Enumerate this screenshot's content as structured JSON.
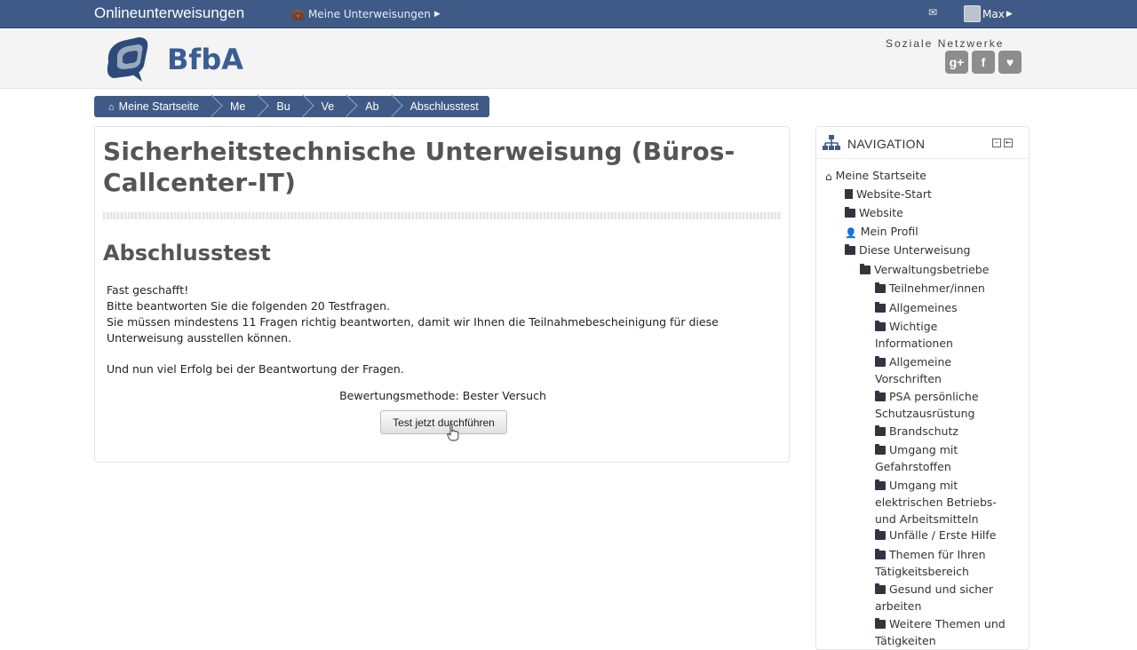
{
  "topbar": {
    "brand": "Onlineunterweisungen",
    "menu_label": "Meine Unterweisungen",
    "user_name": "Max"
  },
  "header": {
    "logo_text": "BfbA",
    "social_title": "Soziale Netzwerke",
    "social": [
      {
        "name": "google-plus-icon",
        "glyph": "g+"
      },
      {
        "name": "facebook-icon",
        "glyph": "f"
      },
      {
        "name": "other-social-icon",
        "glyph": "♥"
      }
    ]
  },
  "breadcrumb": [
    "Meine Startseite",
    "Me",
    "Bu",
    "Ve",
    "Ab",
    "Abschlusstest"
  ],
  "main": {
    "course_title": "Sicherheitstechnische Unterweisung (Büros-Callcenter-IT)",
    "quiz_title": "Abschlusstest",
    "intro_lines": [
      "Fast geschafft!",
      "Bitte beantworten Sie die folgenden 20 Testfragen.",
      "Sie müssen mindestens 11 Fragen richtig beantworten, damit wir Ihnen die Teilnahmebescheinigung für diese Unterweisung ausstellen können."
    ],
    "intro_closing": "Und nun viel Erfolg bei der Beantwortung der Fragen.",
    "grading_method": "Bewertungsmethode: Bester Versuch",
    "start_button": "Test jetzt durchführen"
  },
  "navigation": {
    "title": "NAVIGATION",
    "items": [
      {
        "label": "Meine Startseite",
        "icon": "home-icon"
      },
      {
        "label": "Website-Start",
        "icon": "document-icon"
      },
      {
        "label": "Website",
        "icon": "folder-icon"
      },
      {
        "label": "Mein Profil",
        "icon": "user-icon"
      },
      {
        "label": "Diese Unterweisung",
        "icon": "folder-open-icon"
      },
      {
        "label": "Verwaltungsbetriebe",
        "icon": "folder-open-icon"
      },
      {
        "label": "Teilnehmer/innen",
        "icon": "folder-icon"
      },
      {
        "label": "Allgemeines",
        "icon": "folder-icon"
      },
      {
        "label": "Wichtige Informationen",
        "icon": "folder-icon"
      },
      {
        "label": "Allgemeine Vorschriften",
        "icon": "folder-icon"
      },
      {
        "label": "PSA persönliche Schutzausrüstung",
        "icon": "folder-icon"
      },
      {
        "label": "Brandschutz",
        "icon": "folder-icon"
      },
      {
        "label": "Umgang mit Gefahrstoffen",
        "icon": "folder-icon"
      },
      {
        "label": "Umgang mit elektrischen Betriebs- und Arbeitsmitteln",
        "icon": "folder-icon"
      },
      {
        "label": "Unfälle / Erste Hilfe",
        "icon": "folder-icon"
      },
      {
        "label": "Themen für Ihren Tätigkeitsbereich",
        "icon": "folder-icon"
      },
      {
        "label": "Gesund und sicher arbeiten",
        "icon": "folder-icon"
      },
      {
        "label": "Weitere Themen und Tätigkeiten",
        "icon": "folder-icon"
      }
    ]
  },
  "colors": {
    "navbar": "#3f5a86",
    "heading": "#555555"
  }
}
